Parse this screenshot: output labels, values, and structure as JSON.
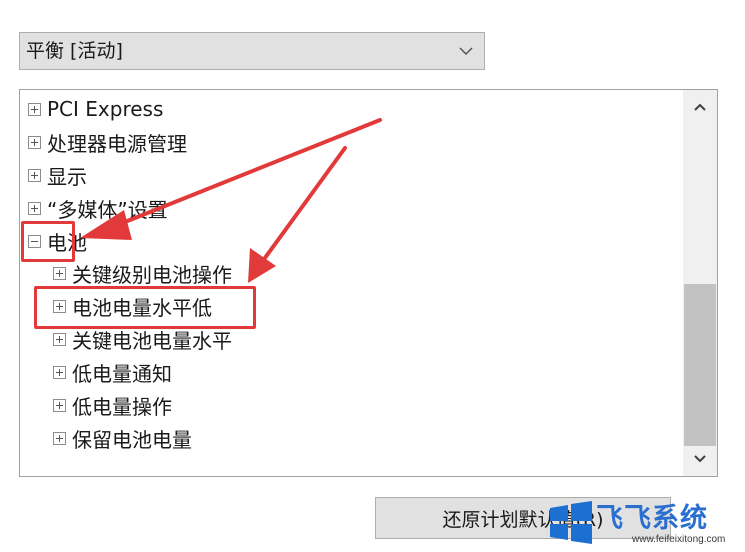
{
  "plan_select": {
    "value": "平衡 [活动]",
    "icon": "chevron-down-icon"
  },
  "tree": {
    "items": [
      {
        "label": "PCI Express",
        "state": "collapsed"
      },
      {
        "label": "处理器电源管理",
        "state": "collapsed"
      },
      {
        "label": "显示",
        "state": "collapsed"
      },
      {
        "label": "“多媒体”设置",
        "state": "collapsed"
      },
      {
        "label": "电池",
        "state": "expanded"
      }
    ],
    "battery_children": [
      {
        "label": "关键级别电池操作",
        "state": "collapsed"
      },
      {
        "label": "电池电量水平低",
        "state": "collapsed"
      },
      {
        "label": "关键电池电量水平",
        "state": "collapsed"
      },
      {
        "label": "低电量通知",
        "state": "collapsed"
      },
      {
        "label": "低电量操作",
        "state": "collapsed"
      },
      {
        "label": "保留电池电量",
        "state": "collapsed"
      }
    ]
  },
  "scrollbar": {
    "up_icon": "chevron-up-icon",
    "down_icon": "chevron-down-icon"
  },
  "restore_button": {
    "label": "还原计划默认值(R)"
  },
  "annotation": {
    "color": "#e23a3a"
  },
  "watermark": {
    "brand": "飞飞系统",
    "url": "www.feifeixitong.com"
  }
}
